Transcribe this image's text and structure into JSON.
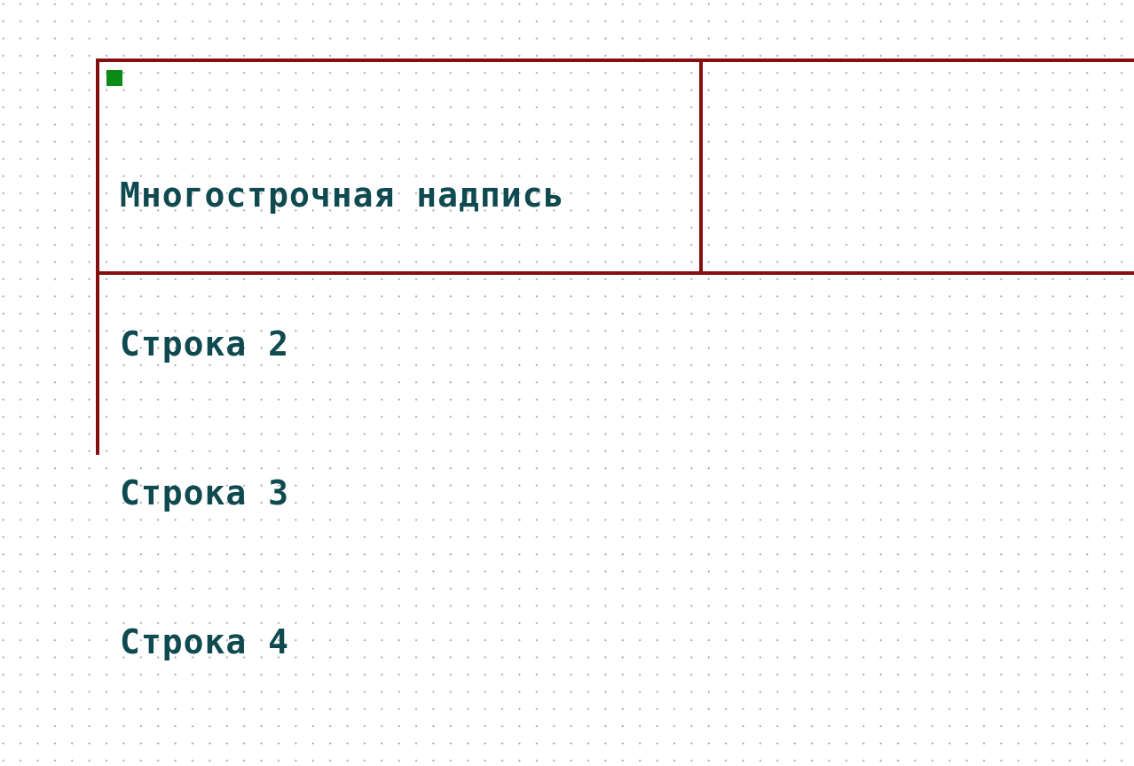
{
  "schematic": {
    "text_lines": [
      "Многострочная надпись",
      "Строка 2",
      "Строка 3",
      "Строка 4"
    ]
  },
  "colors": {
    "background": "#ffffff",
    "grid_dots": "#a9a9a9",
    "frame_lines": "#850e0e",
    "text": "#0f4a50",
    "anchor": "#0a8c16"
  }
}
